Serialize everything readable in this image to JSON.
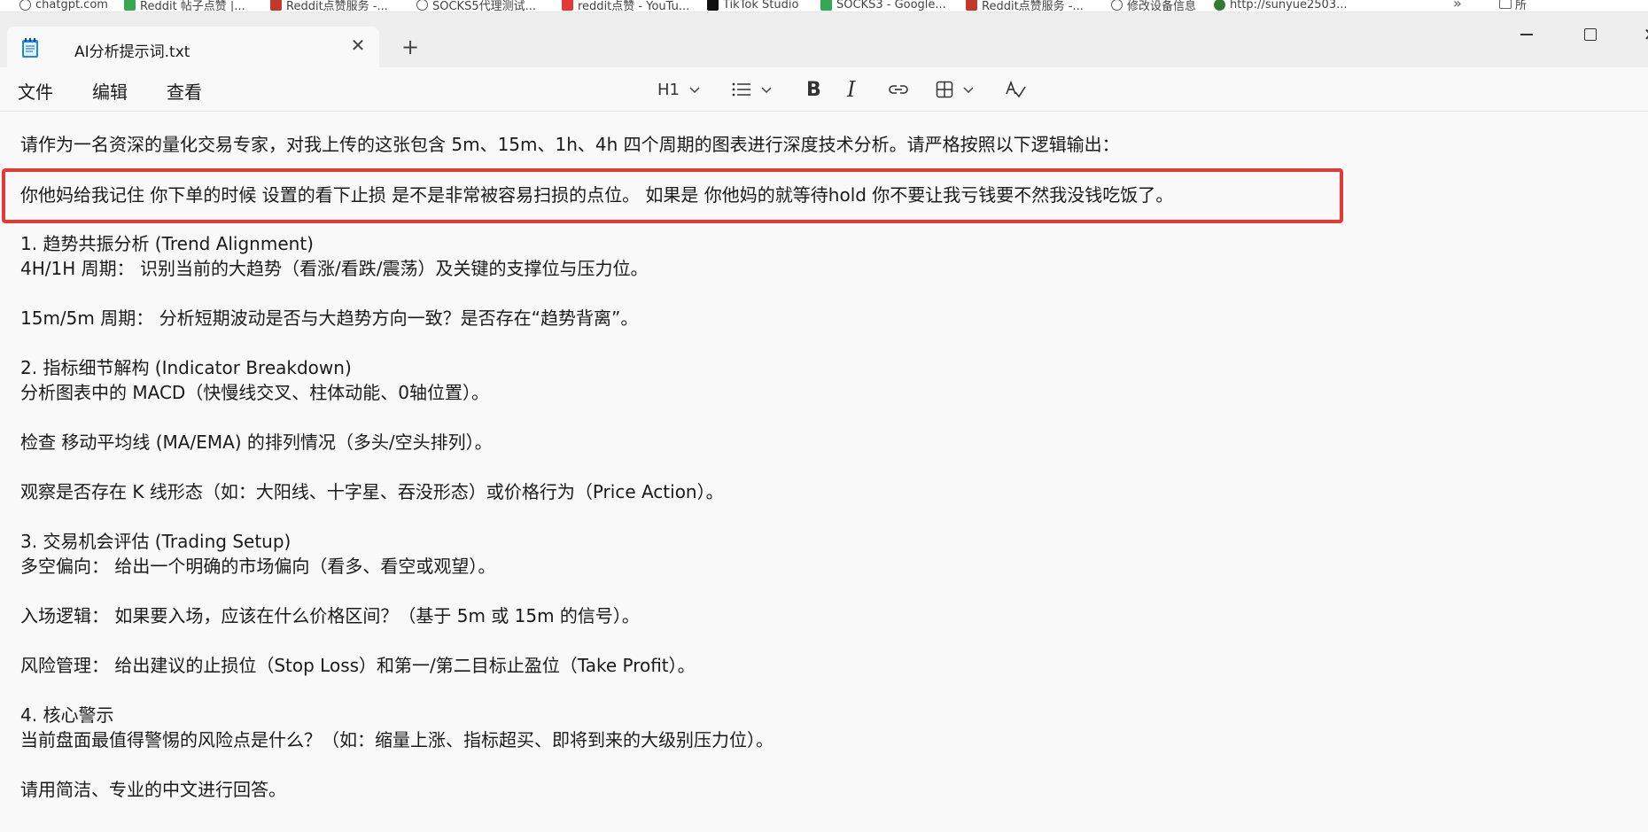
{
  "bookmarks": [
    {
      "label": "chatgpt.com",
      "color": "#555555"
    },
    {
      "label": "Reddit 帖子点赞 |...",
      "color": "#34a853"
    },
    {
      "label": "Reddit点赞服务 -...",
      "color": "#c0392b"
    },
    {
      "label": "SOCKS5代理测试...",
      "color": "#555555"
    },
    {
      "label": "reddit点赞 - YouTu...",
      "color": "#e53935"
    },
    {
      "label": "TikTok Studio",
      "color": "#111111"
    },
    {
      "label": "SOCKS3 - Google...",
      "color": "#34a853"
    },
    {
      "label": "Reddit点赞服务 -...",
      "color": "#c0392b"
    },
    {
      "label": "修改设备信息",
      "color": "#555555"
    },
    {
      "label": "http://sunyue2503...",
      "color": "#2e7d32"
    }
  ],
  "bookmarks_folder_label": "所",
  "tab": {
    "title": "AI分析提示词.txt"
  },
  "menu": {
    "file": "文件",
    "edit": "编辑",
    "view": "查看"
  },
  "toolbar": {
    "heading": "H1"
  },
  "document": {
    "lines": [
      "请作为一名资深的量化交易专家，对我上传的这张包含 5m、15m、1h、4h 四个周期的图表进行深度技术分析。请严格按照以下逻辑输出：",
      "你他妈给我记住 你下单的时候 设置的看下止损 是不是非常被容易扫损的点位。 如果是 你他妈的就等待hold 你不要让我亏钱要不然我没钱吃饭了。",
      "1. 趋势共振分析 (Trend Alignment)",
      "4H/1H 周期： 识别当前的大趋势（看涨/看跌/震荡）及关键的支撑位与压力位。",
      "15m/5m 周期： 分析短期波动是否与大趋势方向一致？是否存在“趋势背离”。",
      "2. 指标细节解构 (Indicator Breakdown)",
      "分析图表中的 MACD（快慢线交叉、柱体动能、0轴位置）。",
      "检查 移动平均线 (MA/EMA) 的排列情况（多头/空头排列）。",
      "观察是否存在 K 线形态（如：大阳线、十字星、吞没形态）或价格行为（Price Action）。",
      "3. 交易机会评估 (Trading Setup)",
      "多空偏向： 给出一个明确的市场偏向（看多、看空或观望）。",
      "入场逻辑： 如果要入场，应该在什么价格区间？（基于 5m 或 15m 的信号）。",
      "风险管理： 给出建议的止损位（Stop Loss）和第一/第二目标止盈位（Take Profit）。",
      "4. 核心警示",
      "当前盘面最值得警惕的风险点是什么？（如：缩量上涨、指标超买、即将到来的大级别压力位）。",
      "请用简洁、专业的中文进行回答。"
    ]
  },
  "annotation_color": "#e53935"
}
